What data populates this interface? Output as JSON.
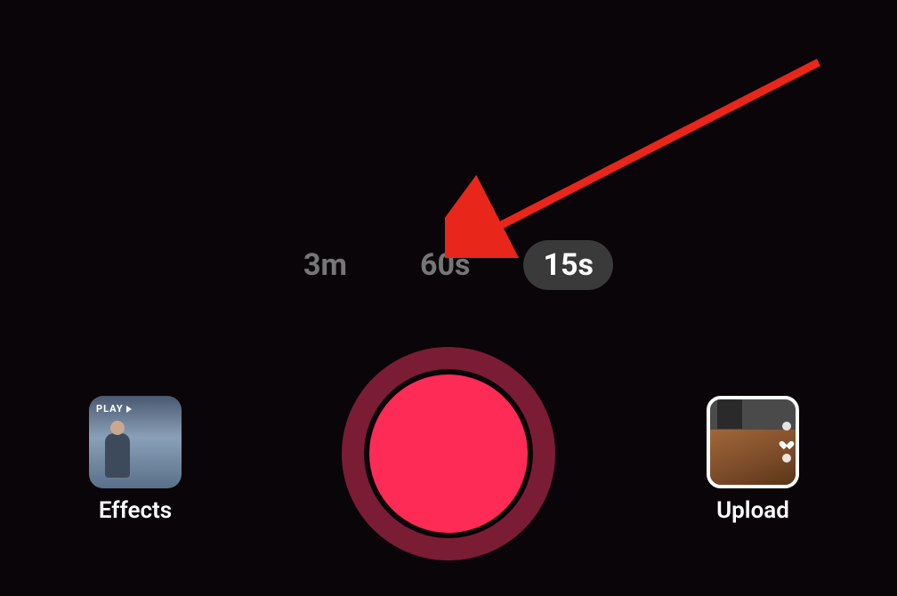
{
  "durations": {
    "options": [
      "3m",
      "60s",
      "15s"
    ],
    "selected_index": 2
  },
  "effects": {
    "label": "Effects",
    "thumb_play_text": "PLAY"
  },
  "upload": {
    "label": "Upload"
  },
  "annotation": {
    "arrow_color": "#e8261a"
  }
}
